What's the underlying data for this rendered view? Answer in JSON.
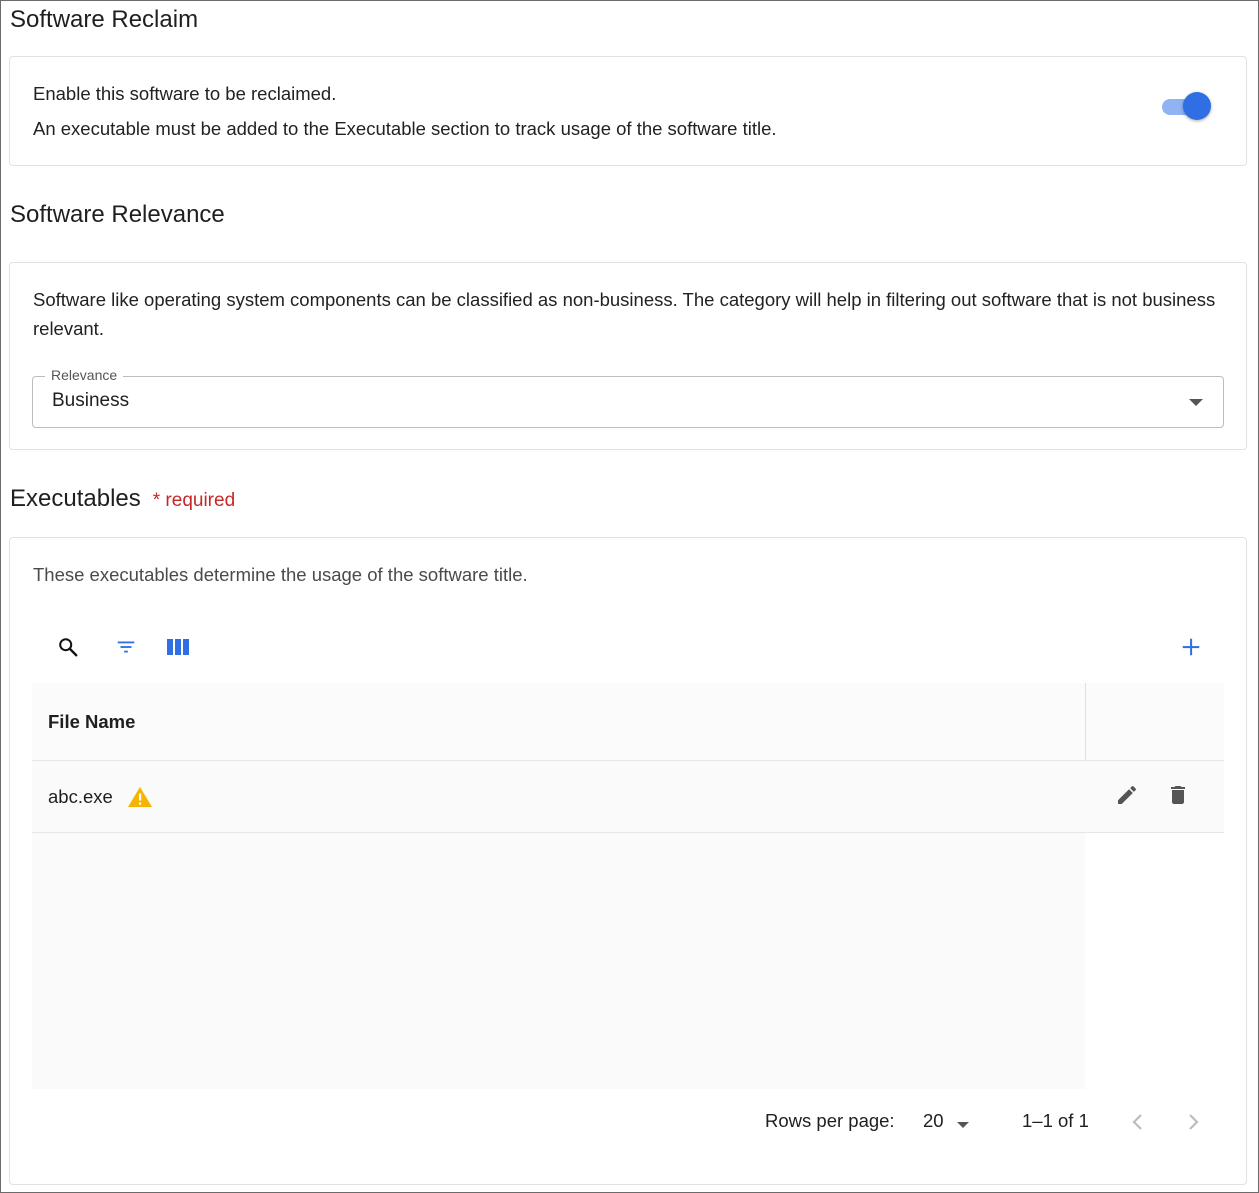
{
  "reclaim": {
    "title": "Software Reclaim",
    "line1": "Enable this software to be reclaimed.",
    "line2": "An executable must be added to the Executable section to track usage of the software title.",
    "enabled": true
  },
  "relevance": {
    "title": "Software Relevance",
    "description": "Software like operating system components can be classified as non-business. The category will help in filtering out software that is not business relevant.",
    "field_label": "Relevance",
    "field_value": "Business"
  },
  "executables": {
    "title": "Executables",
    "required_label": "* required",
    "description": "These executables determine the usage of the software title.",
    "toolbar": {
      "icons": [
        "search-icon",
        "filter-icon",
        "columns-icon",
        "add-icon"
      ]
    },
    "table": {
      "columns": [
        "File Name"
      ],
      "rows": [
        {
          "file_name": "abc.exe",
          "status_icon": "warning-icon"
        }
      ]
    },
    "pagination": {
      "rows_per_page_label": "Rows per page:",
      "rows_per_page_value": "20",
      "range": "1–1 of 1"
    }
  },
  "colors": {
    "accent": "#2f6fe3",
    "warning": "#f5b400",
    "required": "#c62828"
  }
}
